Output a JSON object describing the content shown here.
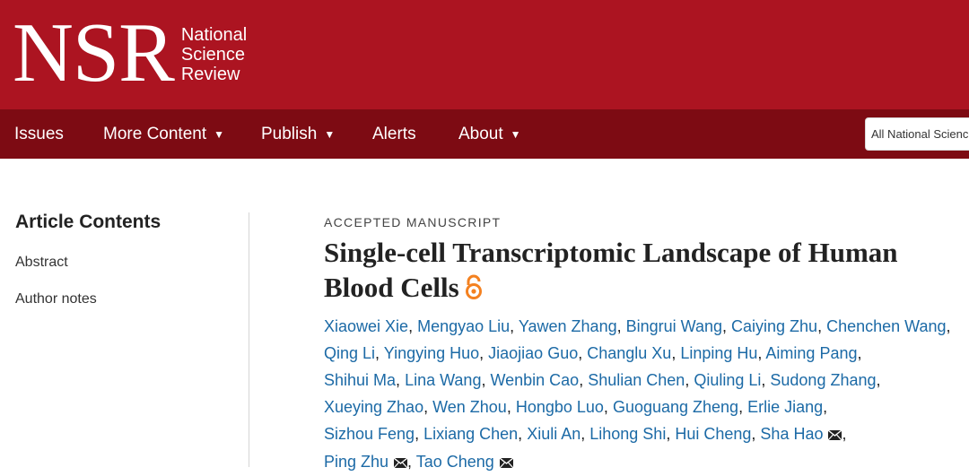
{
  "header": {
    "logo_mark": "NSR",
    "logo_line1": "National",
    "logo_line2": "Science",
    "logo_line3": "Review",
    "brand_color": "#ac1421",
    "nav_color": "#7d0b13"
  },
  "nav": {
    "items": [
      {
        "label": "Issues",
        "has_caret": false
      },
      {
        "label": "More Content",
        "has_caret": true
      },
      {
        "label": "Publish",
        "has_caret": true
      },
      {
        "label": "Alerts",
        "has_caret": false
      },
      {
        "label": "About",
        "has_caret": true
      }
    ],
    "caret_glyph": "▼",
    "search_scope": "All National Science Review"
  },
  "sidebar": {
    "title": "Article Contents",
    "links": [
      "Abstract",
      "Author notes"
    ]
  },
  "article": {
    "kicker": "ACCEPTED MANUSCRIPT",
    "title": "Single-cell Transcriptomic Landscape of Human Blood Cells",
    "open_access_icon": "open-access-icon",
    "link_color": "#1c6aa6",
    "authors": [
      {
        "name": "Xiaowei Xie",
        "corresponding": false
      },
      {
        "name": "Mengyao Liu",
        "corresponding": false
      },
      {
        "name": "Yawen Zhang",
        "corresponding": false
      },
      {
        "name": "Bingrui Wang",
        "corresponding": false
      },
      {
        "name": "Caiying Zhu",
        "corresponding": false
      },
      {
        "name": "Chenchen Wang",
        "corresponding": false
      },
      {
        "name": "Qing Li",
        "corresponding": false
      },
      {
        "name": "Yingying Huo",
        "corresponding": false
      },
      {
        "name": "Jiaojiao Guo",
        "corresponding": false
      },
      {
        "name": "Changlu Xu",
        "corresponding": false
      },
      {
        "name": "Linping Hu",
        "corresponding": false
      },
      {
        "name": "Aiming Pang",
        "corresponding": false
      },
      {
        "name": "Shihui Ma",
        "corresponding": false
      },
      {
        "name": "Lina Wang",
        "corresponding": false
      },
      {
        "name": "Wenbin Cao",
        "corresponding": false
      },
      {
        "name": "Shulian Chen",
        "corresponding": false
      },
      {
        "name": "Qiuling Li",
        "corresponding": false
      },
      {
        "name": "Sudong Zhang",
        "corresponding": false
      },
      {
        "name": "Xueying Zhao",
        "corresponding": false
      },
      {
        "name": "Wen Zhou",
        "corresponding": false
      },
      {
        "name": "Hongbo Luo",
        "corresponding": false
      },
      {
        "name": "Guoguang Zheng",
        "corresponding": false
      },
      {
        "name": "Erlie Jiang",
        "corresponding": false
      },
      {
        "name": "Sizhou Feng",
        "corresponding": false
      },
      {
        "name": "Lixiang Chen",
        "corresponding": false
      },
      {
        "name": "Xiuli An",
        "corresponding": false
      },
      {
        "name": "Lihong Shi",
        "corresponding": false
      },
      {
        "name": "Hui Cheng",
        "corresponding": false
      },
      {
        "name": "Sha Hao",
        "corresponding": true
      },
      {
        "name": "Ping Zhu",
        "corresponding": true
      },
      {
        "name": "Tao Cheng",
        "corresponding": true
      }
    ],
    "author_line_breaks": [
      5,
      11,
      17,
      22,
      28
    ]
  }
}
